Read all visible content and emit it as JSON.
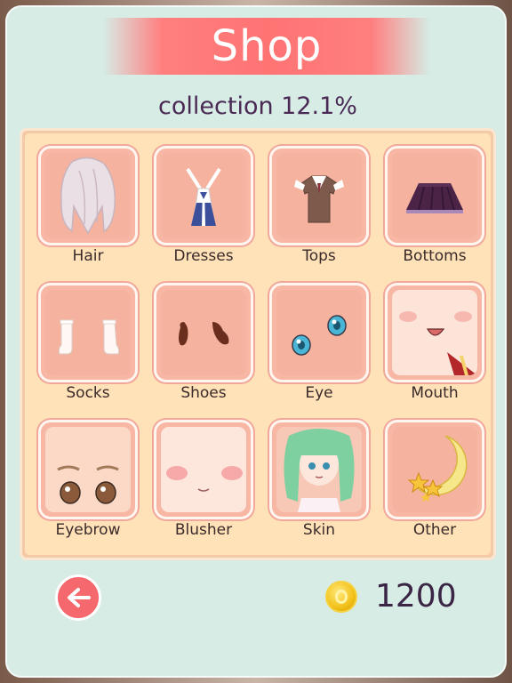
{
  "header": {
    "title": "Shop"
  },
  "collection_text": "collection 12.1%",
  "categories": [
    {
      "label": "Hair",
      "icon": "hair-icon"
    },
    {
      "label": "Dresses",
      "icon": "dress-icon"
    },
    {
      "label": "Tops",
      "icon": "top-icon"
    },
    {
      "label": "Bottoms",
      "icon": "skirt-icon"
    },
    {
      "label": "Socks",
      "icon": "socks-icon"
    },
    {
      "label": "Shoes",
      "icon": "shoes-icon"
    },
    {
      "label": "Eye",
      "icon": "eye-icon"
    },
    {
      "label": "Mouth",
      "icon": "mouth-icon"
    },
    {
      "label": "Eyebrow",
      "icon": "eyebrow-icon"
    },
    {
      "label": "Blusher",
      "icon": "blusher-icon"
    },
    {
      "label": "Skin",
      "icon": "skin-icon"
    },
    {
      "label": "Other",
      "icon": "moon-star-icon"
    }
  ],
  "footer": {
    "back_icon": "arrow-left-icon",
    "coin_icon": "coin-icon",
    "coins": "1200"
  },
  "colors": {
    "banner": "#ff7373",
    "back_button": "#f4686e",
    "tile": "#f8b7a5",
    "panel": "#d6ece5"
  }
}
